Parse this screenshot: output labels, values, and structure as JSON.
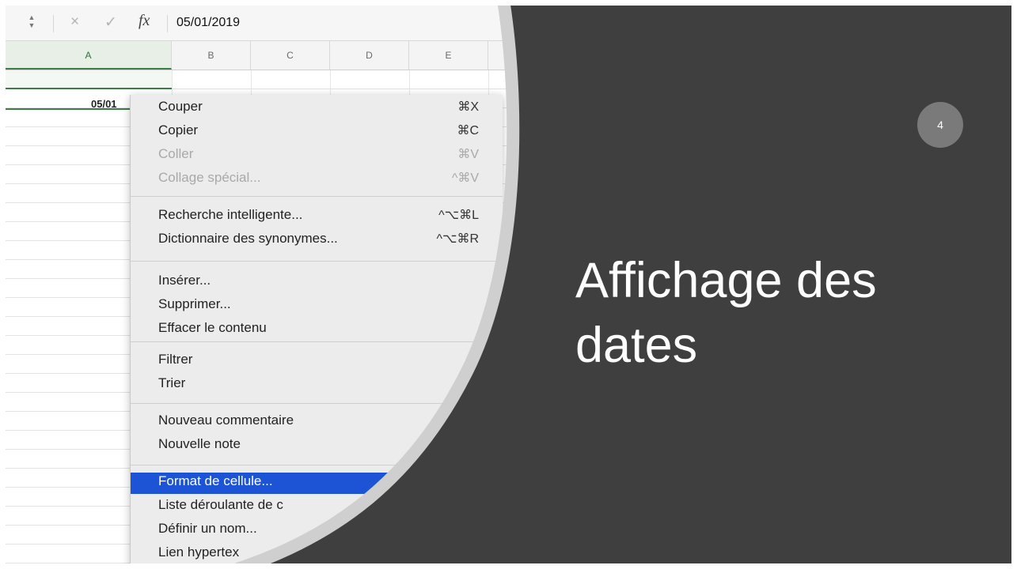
{
  "slide": {
    "number": "4",
    "title_lines": [
      "Affichage des",
      "dates"
    ],
    "colors": {
      "background": "#3f3f3f",
      "curve": "#cfcfcf",
      "frame": "#ffffff",
      "badge": "#7a7a7a"
    }
  },
  "excel": {
    "formula_bar": {
      "cancel_icon": "×",
      "confirm_icon": "✓",
      "fx_label": "fx",
      "value": "05/01/2019"
    },
    "columns": [
      "A",
      "B",
      "C",
      "D",
      "E"
    ],
    "selected_column": "A",
    "cell_value": "05/01",
    "colors": {
      "selection": "#3b7d45"
    }
  },
  "context_menu": {
    "highlight_color": "#1d54d6",
    "groups": [
      [
        {
          "label": "Couper",
          "shortcut": "⌘X",
          "disabled": false
        },
        {
          "label": "Copier",
          "shortcut": "⌘C",
          "disabled": false
        },
        {
          "label": "Coller",
          "shortcut": "⌘V",
          "disabled": true
        },
        {
          "label": "Collage spécial...",
          "shortcut": "^⌘V",
          "disabled": true
        }
      ],
      [
        {
          "label": "Recherche intelligente...",
          "shortcut": "^⌥⌘L",
          "disabled": false
        },
        {
          "label": "Dictionnaire des synonymes...",
          "shortcut": "^⌥⌘R",
          "disabled": false
        }
      ],
      [
        {
          "label": "Insérer...",
          "shortcut": "",
          "disabled": false
        },
        {
          "label": "Supprimer...",
          "shortcut": "",
          "disabled": false
        },
        {
          "label": "Effacer le contenu",
          "shortcut": "",
          "disabled": false
        }
      ],
      [
        {
          "label": "Filtrer",
          "shortcut": "",
          "disabled": false
        },
        {
          "label": "Trier",
          "shortcut": "",
          "disabled": false
        }
      ],
      [
        {
          "label": "Nouveau commentaire",
          "shortcut": "",
          "disabled": false
        },
        {
          "label": "Nouvelle note",
          "shortcut": "",
          "disabled": false
        }
      ],
      [
        {
          "label": "Format de cellule...",
          "shortcut": "",
          "disabled": false,
          "active": true
        },
        {
          "label": "Liste déroulante de c",
          "shortcut": "",
          "disabled": false
        },
        {
          "label": "Définir un nom...",
          "shortcut": "",
          "disabled": false
        },
        {
          "label": "Lien hypertex",
          "shortcut": "",
          "disabled": false
        }
      ]
    ]
  }
}
